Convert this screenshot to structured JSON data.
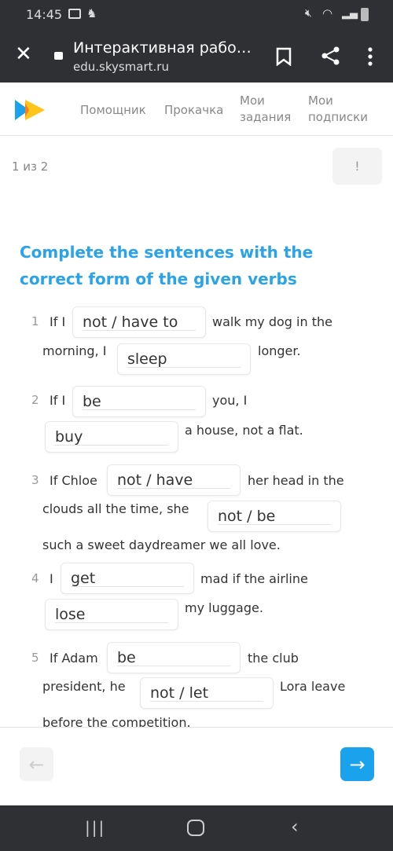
{
  "status_bar": {
    "time": "14:45",
    "icons": [
      "image-icon",
      "notification-icon",
      "mute-icon",
      "wifi-icon",
      "signal-icon",
      "battery-icon"
    ]
  },
  "browser": {
    "page_title": "Интерактивная рабо…",
    "url": "edu.skysmart.ru",
    "icons": [
      "close-icon",
      "lock-icon",
      "bookmark-icon",
      "share-icon",
      "more-icon"
    ]
  },
  "site_nav": {
    "links": [
      {
        "line1": "Помощник",
        "line2": ""
      },
      {
        "line1": "Прокачка",
        "line2": ""
      },
      {
        "line1": "Мои",
        "line2": "задания"
      },
      {
        "line1": "Мои",
        "line2": "подписки"
      }
    ]
  },
  "progress": {
    "label": "1 из 2",
    "report_button": "!"
  },
  "task": {
    "title_line1": "Complete the sentences with the",
    "title_line2": "correct form of the given verbs",
    "items": [
      {
        "number": "1",
        "parts": [
          "If I",
          "walk my dog in the",
          "morning, I",
          "longer."
        ],
        "inputs": [
          "not / have to",
          "sleep"
        ]
      },
      {
        "number": "2",
        "parts": [
          "If I",
          "you, I",
          "a house, not a flat."
        ],
        "inputs": [
          "be",
          "buy"
        ]
      },
      {
        "number": "3",
        "parts": [
          "If Chloe",
          "her head in the",
          "clouds all the time, she",
          "such a sweet daydreamer we all love."
        ],
        "inputs": [
          "not / have",
          "not / be"
        ]
      },
      {
        "number": "4",
        "parts": [
          "I",
          "mad if the airline",
          "my luggage."
        ],
        "inputs": [
          "get",
          "lose"
        ]
      },
      {
        "number": "5",
        "parts": [
          "If Adam",
          "the club",
          "president, he",
          "Lora leave",
          "before the competition."
        ],
        "inputs": [
          "be",
          "not / let"
        ]
      }
    ]
  },
  "colors": {
    "accent": "#1aa3ec",
    "title": "#2ba3e8",
    "chrome": "#2f3033"
  }
}
